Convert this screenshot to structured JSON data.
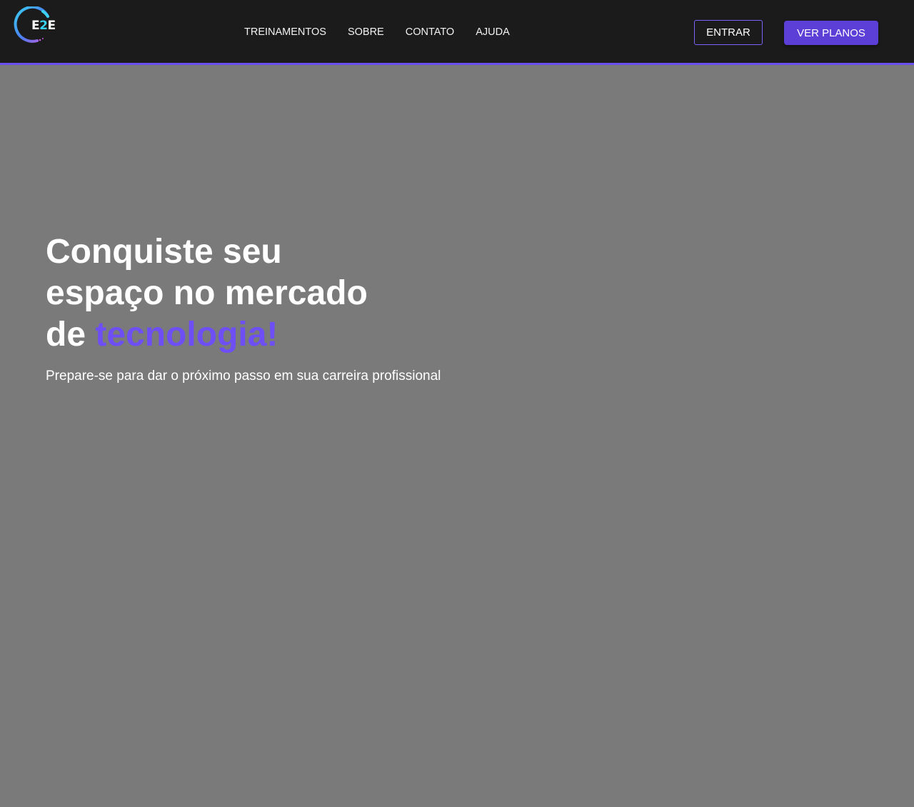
{
  "brand": {
    "logo_mark": "E2E",
    "logo_mark_left": "E",
    "logo_mark_mid": "2",
    "logo_mark_right": "E",
    "logo_icon": "circular-arc-logo-icon",
    "colors": {
      "accent": "#6d4ff5",
      "cyan": "#3ad0f0",
      "magenta": "#c85be0"
    }
  },
  "nav": {
    "links": [
      {
        "label": "TREINAMENTOS"
      },
      {
        "label": "SOBRE"
      },
      {
        "label": "CONTATO"
      },
      {
        "label": "AJUDA"
      }
    ],
    "login_label": "ENTRAR",
    "plans_label": "VER PLANOS",
    "colors": {
      "background": "#1b1b1c",
      "border": "#6a4ff0",
      "plans_button": "#5b3fd6"
    }
  },
  "hero": {
    "title_line1": "Conquiste seu",
    "title_line2": "espaço no mercado",
    "title_line3_prefix": "de ",
    "title_highlight": "tecnologia!",
    "subtitle": "Prepare-se para dar o próximo passo em sua carreira profissional",
    "colors": {
      "background": "#7a7a7a",
      "text": "#ffffff",
      "highlight": "#6d4ff5"
    }
  }
}
